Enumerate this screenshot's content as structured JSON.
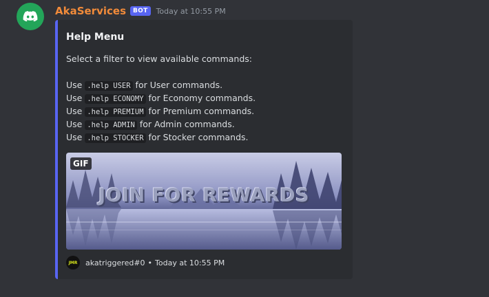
{
  "message": {
    "username": "AkaServices",
    "bot_tag": "BOT",
    "timestamp": "Today at 10:55 PM",
    "avatar_icon": "discord-logo-icon",
    "avatar_color": "#23a559"
  },
  "embed": {
    "accent_color": "#5865f2",
    "title": "Help Menu",
    "intro": "Select a filter to view available commands:",
    "commands": [
      {
        "prefix": "Use",
        "code": ".help USER",
        "suffix": "for User commands."
      },
      {
        "prefix": "Use",
        "code": ".help ECONOMY",
        "suffix": "for Economy commands."
      },
      {
        "prefix": "Use",
        "code": ".help PREMIUM",
        "suffix": "for Premium commands."
      },
      {
        "prefix": "Use",
        "code": ".help ADMIN",
        "suffix": "for Admin commands."
      },
      {
        "prefix": "Use",
        "code": ".help STOCKER",
        "suffix": "for Stocker commands."
      }
    ],
    "image": {
      "badge": "GIF",
      "text": "JOIN FOR REWARDS"
    },
    "footer": {
      "avatar_text": "JMR",
      "author": "akatriggered#0",
      "separator": "•",
      "time": "Today at 10:55 PM"
    }
  }
}
